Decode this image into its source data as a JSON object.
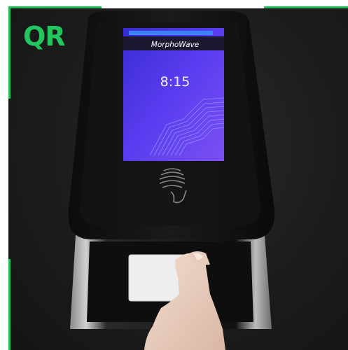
{
  "corner_label": "QR",
  "device": {
    "brand": "MorphoWave",
    "time": "8:15"
  },
  "colors": {
    "accent": "#22c55e",
    "screen": "#5a3df0",
    "status_bar": "#3b82f6"
  }
}
